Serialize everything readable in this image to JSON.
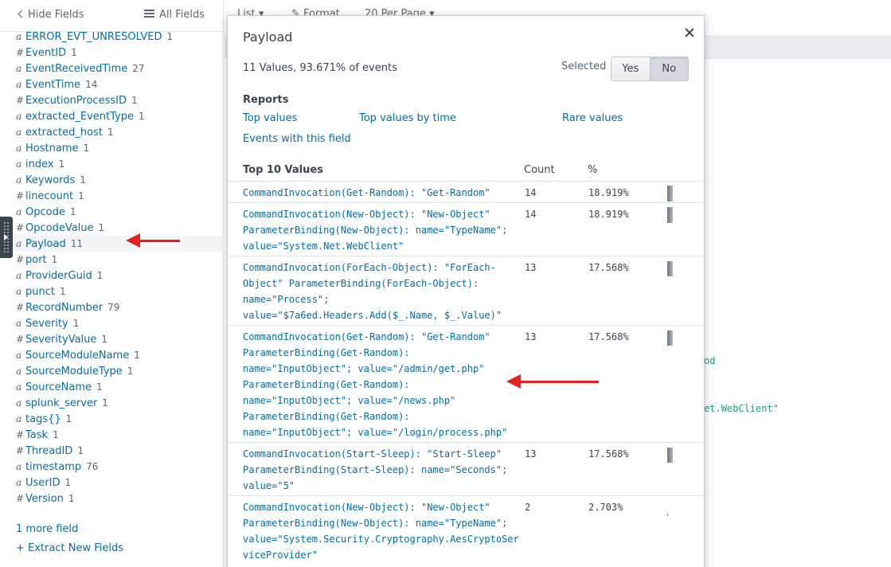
{
  "sidebar": {
    "hide_fields": "Hide Fields",
    "all_fields": "All Fields",
    "fields": [
      {
        "type": "a",
        "name": "ERROR_EVT_UNRESOLVED",
        "count": "1"
      },
      {
        "type": "#",
        "name": "EventID",
        "count": "1"
      },
      {
        "type": "a",
        "name": "EventReceivedTime",
        "count": "27"
      },
      {
        "type": "a",
        "name": "EventTime",
        "count": "14"
      },
      {
        "type": "#",
        "name": "ExecutionProcessID",
        "count": "1"
      },
      {
        "type": "a",
        "name": "extracted_EventType",
        "count": "1"
      },
      {
        "type": "a",
        "name": "extracted_host",
        "count": "1"
      },
      {
        "type": "a",
        "name": "Hostname",
        "count": "1"
      },
      {
        "type": "a",
        "name": "index",
        "count": "1"
      },
      {
        "type": "a",
        "name": "Keywords",
        "count": "1"
      },
      {
        "type": "#",
        "name": "linecount",
        "count": "1"
      },
      {
        "type": "a",
        "name": "Opcode",
        "count": "1"
      },
      {
        "type": "#",
        "name": "OpcodeValue",
        "count": "1"
      },
      {
        "type": "a",
        "name": "Payload",
        "count": "11"
      },
      {
        "type": "#",
        "name": "port",
        "count": "1"
      },
      {
        "type": "a",
        "name": "ProviderGuid",
        "count": "1"
      },
      {
        "type": "a",
        "name": "punct",
        "count": "1"
      },
      {
        "type": "#",
        "name": "RecordNumber",
        "count": "79"
      },
      {
        "type": "a",
        "name": "Severity",
        "count": "1"
      },
      {
        "type": "#",
        "name": "SeverityValue",
        "count": "1"
      },
      {
        "type": "a",
        "name": "SourceModuleName",
        "count": "1"
      },
      {
        "type": "a",
        "name": "SourceModuleType",
        "count": "1"
      },
      {
        "type": "a",
        "name": "SourceName",
        "count": "1"
      },
      {
        "type": "a",
        "name": "splunk_server",
        "count": "1"
      },
      {
        "type": "a",
        "name": "tags{}",
        "count": "1"
      },
      {
        "type": "#",
        "name": "Task",
        "count": "1"
      },
      {
        "type": "#",
        "name": "ThreadID",
        "count": "1"
      },
      {
        "type": "a",
        "name": "timestamp",
        "count": "76"
      },
      {
        "type": "a",
        "name": "UserID",
        "count": "1"
      },
      {
        "type": "#",
        "name": "Version",
        "count": "1"
      }
    ],
    "more_field": "1 more field",
    "extract_new_fields": "+ Extract New Fields"
  },
  "toolbar": {
    "list": "List ▾",
    "format": "✎ Format",
    "per_page": "20 Per Page ▾"
  },
  "background": {
    "fragment1": "od",
    "fragment2": "et.WebClient\""
  },
  "popup": {
    "title": "Payload",
    "close_icon": "close-icon",
    "summary": "11 Values, 93.671% of events",
    "selected_label": "Selected",
    "yes": "Yes",
    "no": "No",
    "reports_heading": "Reports",
    "reports": {
      "top_values": "Top values",
      "top_values_by_time": "Top values by time",
      "rare_values": "Rare values",
      "events_with_field": "Events with this field"
    },
    "table": {
      "col_values": "Top 10 Values",
      "col_count": "Count",
      "col_pct": "%",
      "rows": [
        {
          "value": "CommandInvocation(Get-Random): \"Get-Random\"",
          "count": "14",
          "pct": "18.919%",
          "fraction": 0.18919
        },
        {
          "value": "CommandInvocation(New-Object): \"New-Object\"\nParameterBinding(New-Object): name=\"TypeName\";\nvalue=\"System.Net.WebClient\"",
          "count": "14",
          "pct": "18.919%",
          "fraction": 0.18919
        },
        {
          "value": "CommandInvocation(ForEach-Object): \"ForEach-\nObject\" ParameterBinding(ForEach-Object):\nname=\"Process\";\nvalue=\"$7a6ed.Headers.Add($_.Name, $_.Value)\"",
          "count": "13",
          "pct": "17.568%",
          "fraction": 0.17568
        },
        {
          "value": "CommandInvocation(Get-Random): \"Get-Random\"\nParameterBinding(Get-Random):\nname=\"InputObject\"; value=\"/admin/get.php\"\nParameterBinding(Get-Random):\nname=\"InputObject\"; value=\"/news.php\"\nParameterBinding(Get-Random):\nname=\"InputObject\"; value=\"/login/process.php\"",
          "count": "13",
          "pct": "17.568%",
          "fraction": 0.17568
        },
        {
          "value": "CommandInvocation(Start-Sleep): \"Start-Sleep\"\nParameterBinding(Start-Sleep): name=\"Seconds\";\nvalue=\"5\"",
          "count": "13",
          "pct": "17.568%",
          "fraction": 0.17568
        },
        {
          "value": "CommandInvocation(New-Object): \"New-Object\"\nParameterBinding(New-Object): name=\"TypeName\";\nvalue=\"System.Security.Cryptography.AesCryptoSer\nviceProvider\"",
          "count": "2",
          "pct": "2.703%",
          "fraction": 0.02703
        }
      ]
    }
  },
  "colors": {
    "link": "#006eaa",
    "arrow": "#e5211b",
    "text": "#3c444d"
  }
}
